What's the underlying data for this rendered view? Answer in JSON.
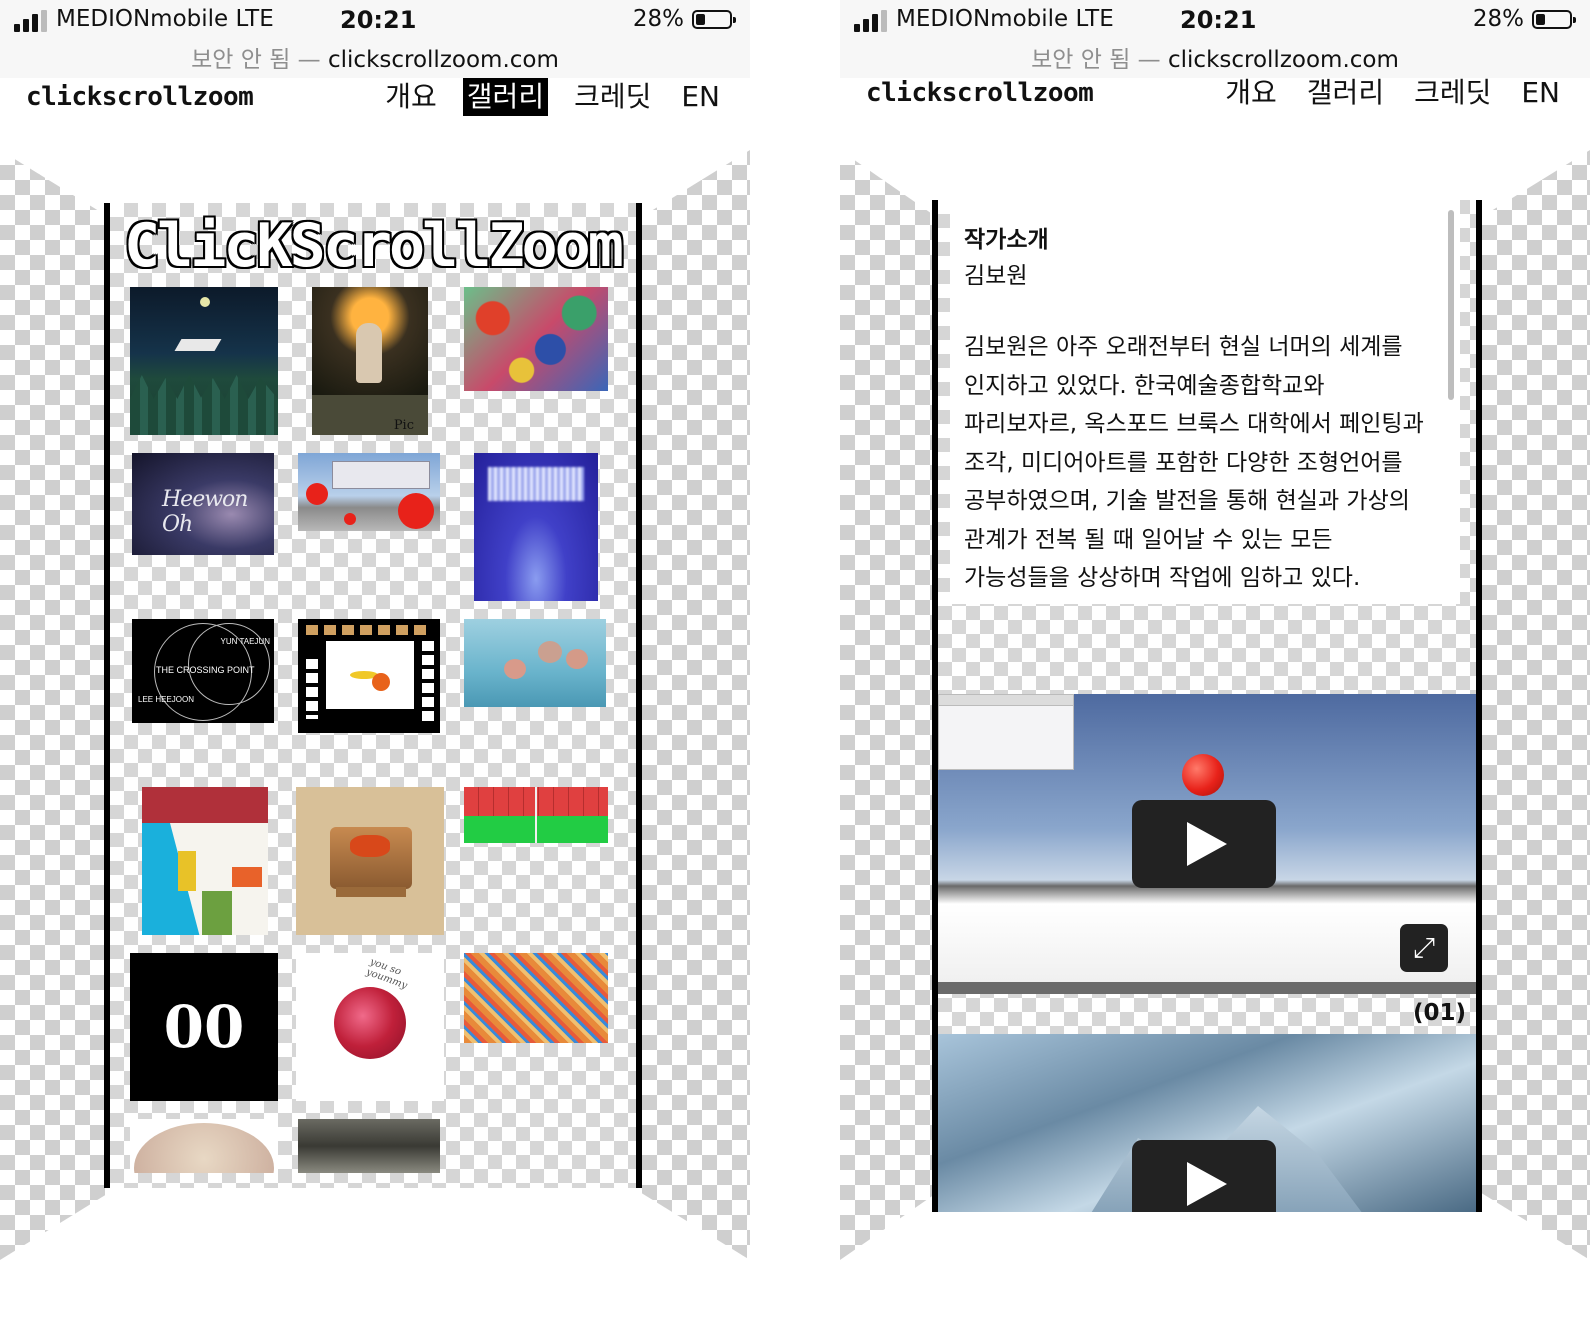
{
  "status_bar": {
    "carrier": "MEDIONmobile   LTE",
    "time": "20:21",
    "battery_percent": "28%",
    "battery_level": 0.28,
    "url_note": "보안 안 됨 —",
    "url": "clickscrollzoom.com"
  },
  "site": {
    "brand": "clickscrollzoom",
    "nav": [
      "개요",
      "갤러리",
      "크레딧",
      "EN"
    ]
  },
  "gallery": {
    "logo_title": "ClicKScrollZoom",
    "thumb_texts": {
      "pic": "Pic",
      "heewon": "Heewon Oh",
      "crossing_artist_top": "YUN TAEJUN",
      "crossing_title": "THE CROSSING POINT",
      "crossing_artist_bottom": "LEE HEEJOON",
      "zero": "00",
      "you": "you so yoummy"
    }
  },
  "detail": {
    "bio_heading": "작가소개",
    "artist_name": "김보원",
    "bio_lines": [
      "김보원은 아주 오래전부터 현실 너머의 세계를",
      "인지하고 있었다. 한국예술종합학교와",
      "파리보자르, 옥스포드 브룩스 대학에서 페인팅과",
      "조각, 미디어아트를 포함한 다양한 조형언어를",
      "공부하였으며, 기술 발전을 통해 현실과 가상의",
      "관계가 전복 될 때 일어날 수 있는 모든",
      "가능성들을 상상하며 작업에 임하고 있다."
    ],
    "video_counter": "(01)",
    "icons": {
      "play": "play-icon",
      "fullscreen": "expand-icon"
    }
  },
  "colors": {
    "accent": "#000000",
    "checker": "#cfcfcf",
    "ball": "#e8221a"
  }
}
